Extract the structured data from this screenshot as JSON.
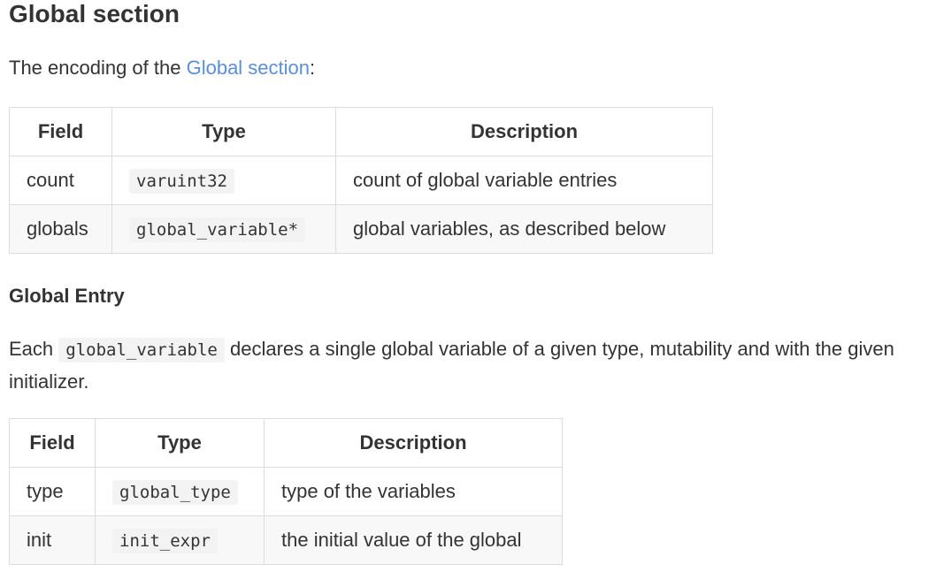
{
  "heading": "Global section",
  "intro": {
    "prefix": "The encoding of the ",
    "link": "Global section",
    "suffix": ":"
  },
  "table1": {
    "headers": [
      "Field",
      "Type",
      "Description"
    ],
    "rows": [
      {
        "field": "count",
        "type": "varuint32",
        "description": "count of global variable entries"
      },
      {
        "field": "globals",
        "type": "global_variable*",
        "description": "global variables, as described below"
      }
    ]
  },
  "subheading": "Global Entry",
  "entry_text": {
    "prefix": "Each ",
    "code": "global_variable",
    "suffix": " declares a single global variable of a given type, mutability and with the given initializer."
  },
  "table2": {
    "headers": [
      "Field",
      "Type",
      "Description"
    ],
    "rows": [
      {
        "field": "type",
        "type": "global_type",
        "description": "type of the variables"
      },
      {
        "field": "init",
        "type": "init_expr",
        "description": "the initial value of the global"
      }
    ]
  }
}
